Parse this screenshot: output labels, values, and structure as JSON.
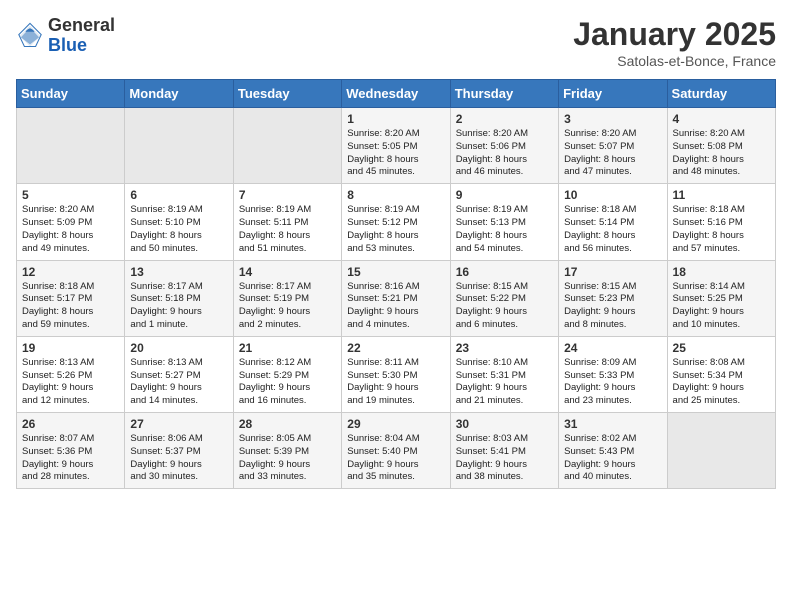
{
  "logo": {
    "general": "General",
    "blue": "Blue"
  },
  "title": "January 2025",
  "subtitle": "Satolas-et-Bonce, France",
  "days_of_week": [
    "Sunday",
    "Monday",
    "Tuesday",
    "Wednesday",
    "Thursday",
    "Friday",
    "Saturday"
  ],
  "weeks": [
    [
      {
        "day": "",
        "info": ""
      },
      {
        "day": "",
        "info": ""
      },
      {
        "day": "",
        "info": ""
      },
      {
        "day": "1",
        "info": "Sunrise: 8:20 AM\nSunset: 5:05 PM\nDaylight: 8 hours\nand 45 minutes."
      },
      {
        "day": "2",
        "info": "Sunrise: 8:20 AM\nSunset: 5:06 PM\nDaylight: 8 hours\nand 46 minutes."
      },
      {
        "day": "3",
        "info": "Sunrise: 8:20 AM\nSunset: 5:07 PM\nDaylight: 8 hours\nand 47 minutes."
      },
      {
        "day": "4",
        "info": "Sunrise: 8:20 AM\nSunset: 5:08 PM\nDaylight: 8 hours\nand 48 minutes."
      }
    ],
    [
      {
        "day": "5",
        "info": "Sunrise: 8:20 AM\nSunset: 5:09 PM\nDaylight: 8 hours\nand 49 minutes."
      },
      {
        "day": "6",
        "info": "Sunrise: 8:19 AM\nSunset: 5:10 PM\nDaylight: 8 hours\nand 50 minutes."
      },
      {
        "day": "7",
        "info": "Sunrise: 8:19 AM\nSunset: 5:11 PM\nDaylight: 8 hours\nand 51 minutes."
      },
      {
        "day": "8",
        "info": "Sunrise: 8:19 AM\nSunset: 5:12 PM\nDaylight: 8 hours\nand 53 minutes."
      },
      {
        "day": "9",
        "info": "Sunrise: 8:19 AM\nSunset: 5:13 PM\nDaylight: 8 hours\nand 54 minutes."
      },
      {
        "day": "10",
        "info": "Sunrise: 8:18 AM\nSunset: 5:14 PM\nDaylight: 8 hours\nand 56 minutes."
      },
      {
        "day": "11",
        "info": "Sunrise: 8:18 AM\nSunset: 5:16 PM\nDaylight: 8 hours\nand 57 minutes."
      }
    ],
    [
      {
        "day": "12",
        "info": "Sunrise: 8:18 AM\nSunset: 5:17 PM\nDaylight: 8 hours\nand 59 minutes."
      },
      {
        "day": "13",
        "info": "Sunrise: 8:17 AM\nSunset: 5:18 PM\nDaylight: 9 hours\nand 1 minute."
      },
      {
        "day": "14",
        "info": "Sunrise: 8:17 AM\nSunset: 5:19 PM\nDaylight: 9 hours\nand 2 minutes."
      },
      {
        "day": "15",
        "info": "Sunrise: 8:16 AM\nSunset: 5:21 PM\nDaylight: 9 hours\nand 4 minutes."
      },
      {
        "day": "16",
        "info": "Sunrise: 8:15 AM\nSunset: 5:22 PM\nDaylight: 9 hours\nand 6 minutes."
      },
      {
        "day": "17",
        "info": "Sunrise: 8:15 AM\nSunset: 5:23 PM\nDaylight: 9 hours\nand 8 minutes."
      },
      {
        "day": "18",
        "info": "Sunrise: 8:14 AM\nSunset: 5:25 PM\nDaylight: 9 hours\nand 10 minutes."
      }
    ],
    [
      {
        "day": "19",
        "info": "Sunrise: 8:13 AM\nSunset: 5:26 PM\nDaylight: 9 hours\nand 12 minutes."
      },
      {
        "day": "20",
        "info": "Sunrise: 8:13 AM\nSunset: 5:27 PM\nDaylight: 9 hours\nand 14 minutes."
      },
      {
        "day": "21",
        "info": "Sunrise: 8:12 AM\nSunset: 5:29 PM\nDaylight: 9 hours\nand 16 minutes."
      },
      {
        "day": "22",
        "info": "Sunrise: 8:11 AM\nSunset: 5:30 PM\nDaylight: 9 hours\nand 19 minutes."
      },
      {
        "day": "23",
        "info": "Sunrise: 8:10 AM\nSunset: 5:31 PM\nDaylight: 9 hours\nand 21 minutes."
      },
      {
        "day": "24",
        "info": "Sunrise: 8:09 AM\nSunset: 5:33 PM\nDaylight: 9 hours\nand 23 minutes."
      },
      {
        "day": "25",
        "info": "Sunrise: 8:08 AM\nSunset: 5:34 PM\nDaylight: 9 hours\nand 25 minutes."
      }
    ],
    [
      {
        "day": "26",
        "info": "Sunrise: 8:07 AM\nSunset: 5:36 PM\nDaylight: 9 hours\nand 28 minutes."
      },
      {
        "day": "27",
        "info": "Sunrise: 8:06 AM\nSunset: 5:37 PM\nDaylight: 9 hours\nand 30 minutes."
      },
      {
        "day": "28",
        "info": "Sunrise: 8:05 AM\nSunset: 5:39 PM\nDaylight: 9 hours\nand 33 minutes."
      },
      {
        "day": "29",
        "info": "Sunrise: 8:04 AM\nSunset: 5:40 PM\nDaylight: 9 hours\nand 35 minutes."
      },
      {
        "day": "30",
        "info": "Sunrise: 8:03 AM\nSunset: 5:41 PM\nDaylight: 9 hours\nand 38 minutes."
      },
      {
        "day": "31",
        "info": "Sunrise: 8:02 AM\nSunset: 5:43 PM\nDaylight: 9 hours\nand 40 minutes."
      },
      {
        "day": "",
        "info": ""
      }
    ]
  ]
}
